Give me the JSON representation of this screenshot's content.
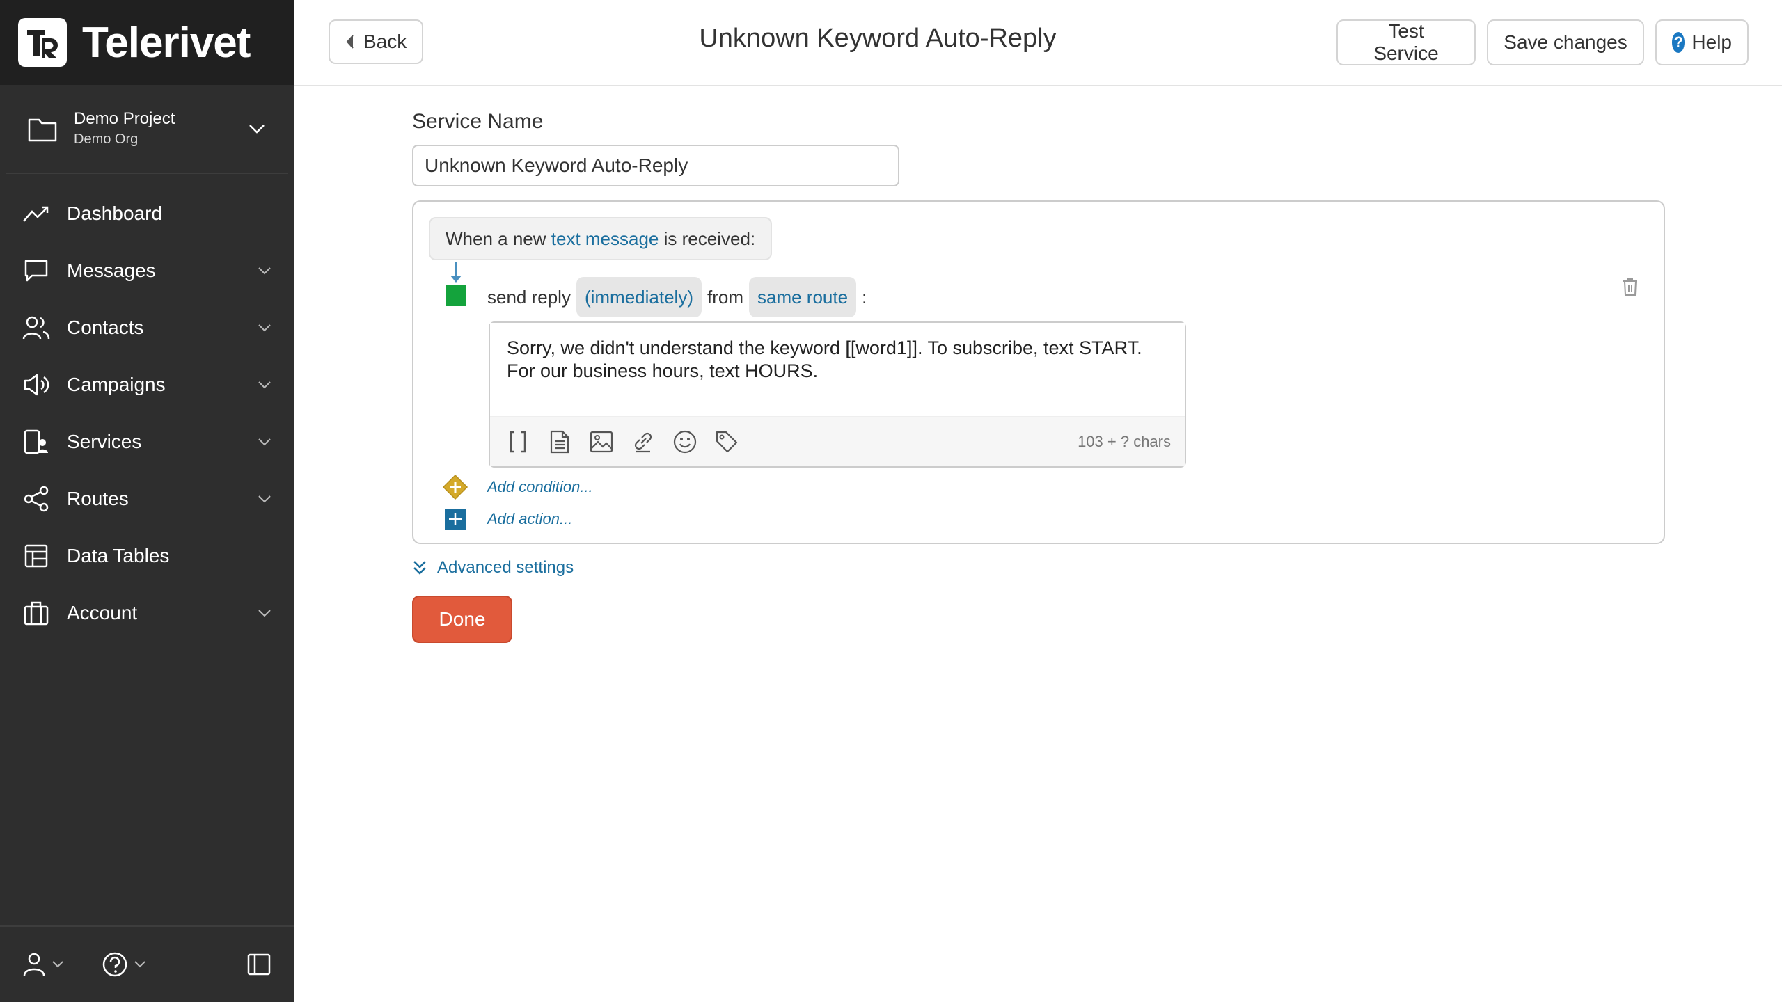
{
  "app": {
    "brand": "Telerivet",
    "logo_letters": "TR"
  },
  "project": {
    "name": "Demo Project",
    "org": "Demo Org"
  },
  "sidebar": {
    "items": [
      {
        "label": "Dashboard",
        "icon": "trend-icon",
        "expandable": false
      },
      {
        "label": "Messages",
        "icon": "chat-icon",
        "expandable": true
      },
      {
        "label": "Contacts",
        "icon": "users-icon",
        "expandable": true
      },
      {
        "label": "Campaigns",
        "icon": "megaphone-icon",
        "expandable": true
      },
      {
        "label": "Services",
        "icon": "services-icon",
        "expandable": true
      },
      {
        "label": "Routes",
        "icon": "share-icon",
        "expandable": true
      },
      {
        "label": "Data Tables",
        "icon": "table-icon",
        "expandable": false
      },
      {
        "label": "Account",
        "icon": "briefcase-icon",
        "expandable": true
      }
    ]
  },
  "header": {
    "back_label": "Back",
    "title": "Unknown Keyword Auto-Reply",
    "test_label": "Test Service",
    "save_label": "Save changes",
    "help_label": "Help"
  },
  "form": {
    "name_label": "Service Name",
    "name_value": "Unknown Keyword Auto-Reply"
  },
  "flow": {
    "trigger_prefix": "When a new",
    "trigger_link": "text message",
    "trigger_suffix": "is received:",
    "action_label": "send reply",
    "timing": "(immediately)",
    "from_label": "from",
    "route": "same route",
    "colon": ":",
    "message": "Sorry, we didn't understand the keyword [[word1]]. To subscribe, text START. For our business hours, text HOURS.",
    "chars": "103 + ? chars",
    "add_condition": "Add condition...",
    "add_action": "Add action..."
  },
  "advanced_label": "Advanced settings",
  "done_label": "Done",
  "colors": {
    "sidebar_bg": "#2e2e2e",
    "link": "#1a6e9e",
    "done": "#e15a3c",
    "action_green": "#14a33c",
    "condition_gold": "#d4a92a",
    "add_blue": "#1a6e9e"
  }
}
